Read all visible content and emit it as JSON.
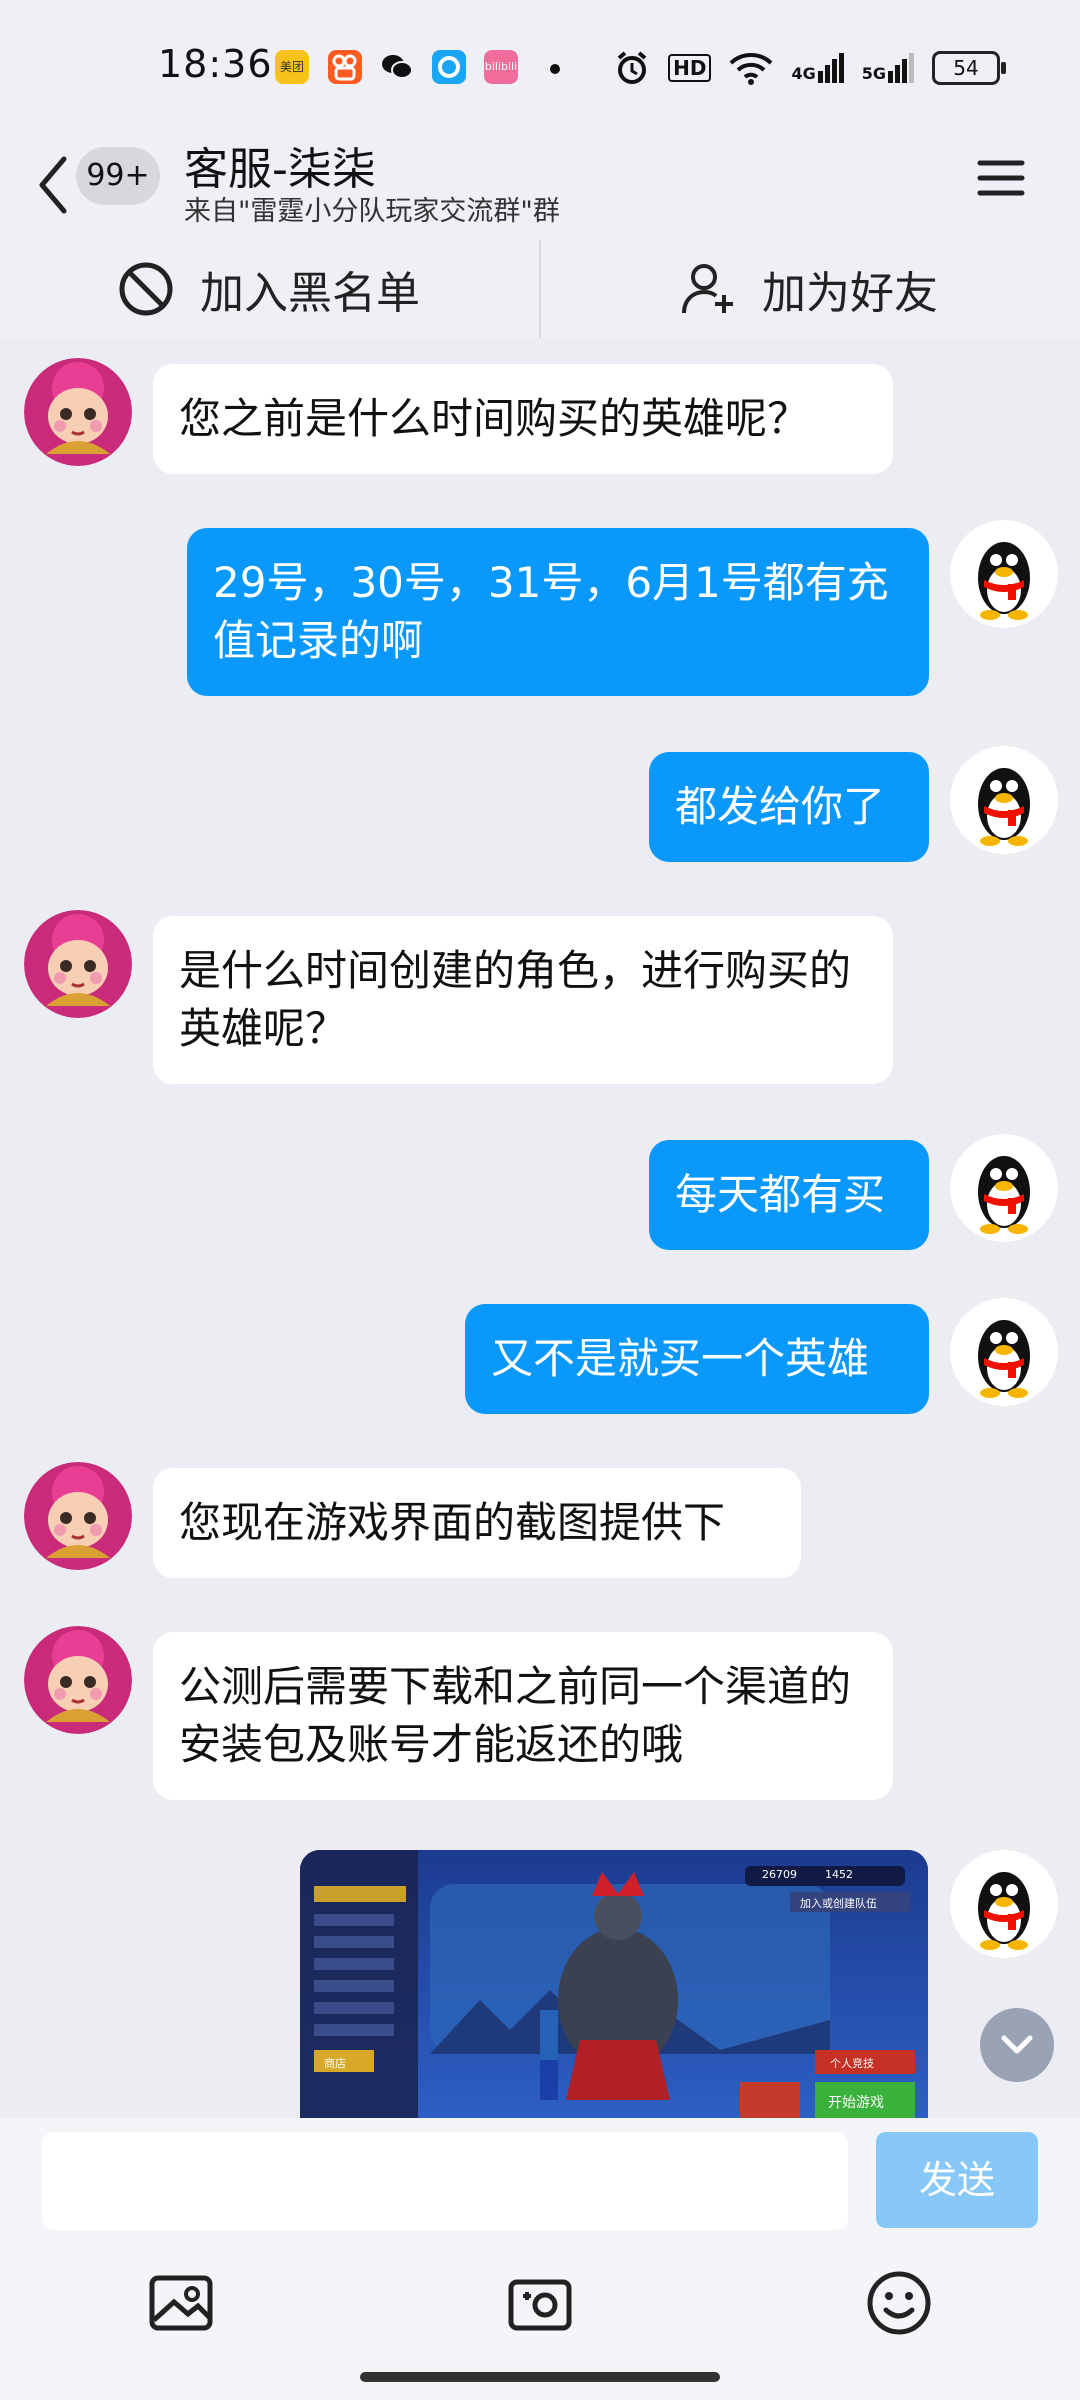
{
  "status_bar": {
    "time": "18:36",
    "app_icons": [
      "美团",
      "kuaishou-icon",
      "wechat-icon",
      "ele-me-icon",
      "bilibili"
    ],
    "network_labels": [
      "HD",
      "4G",
      "5G"
    ],
    "battery": "54"
  },
  "header": {
    "unread_badge": "99+",
    "title": "客服-柒柒",
    "subtitle": "来自\"雷霆小分队玩家交流群\"群"
  },
  "actions": {
    "blacklist_label": "加入黑名单",
    "add_friend_label": "加为好友"
  },
  "messages": [
    {
      "side": "in",
      "text": "您之前是什么时间购买的英雄呢？"
    },
    {
      "side": "out",
      "text": "29号，30号，31号，6月1号都有充值记录的啊"
    },
    {
      "side": "out",
      "text": "都发给你了"
    },
    {
      "side": "in",
      "text": "是什么时间创建的角色，进行购买的英雄呢？"
    },
    {
      "side": "out",
      "text": "每天都有买"
    },
    {
      "side": "out",
      "text": "又不是就买一个英雄"
    },
    {
      "side": "in",
      "text": "您现在游戏界面的截图提供下"
    },
    {
      "side": "in",
      "text": "公测后需要下载和之前同一个渠道的安装包及账号才能返还的哦"
    },
    {
      "side": "out",
      "type": "image",
      "text": "game-screenshot"
    }
  ],
  "screenshot_texts": {
    "coins": "26709",
    "gems": "1452",
    "join_team": "加入或创建队伍",
    "personal_match": "个人竞技",
    "start_game": "开始游戏",
    "shop": "商店"
  },
  "input": {
    "placeholder": "",
    "send_label": "发送"
  },
  "colors": {
    "accent": "#0a99fa",
    "send_disabled": "#88c8f8",
    "background": "#ecedf2"
  }
}
